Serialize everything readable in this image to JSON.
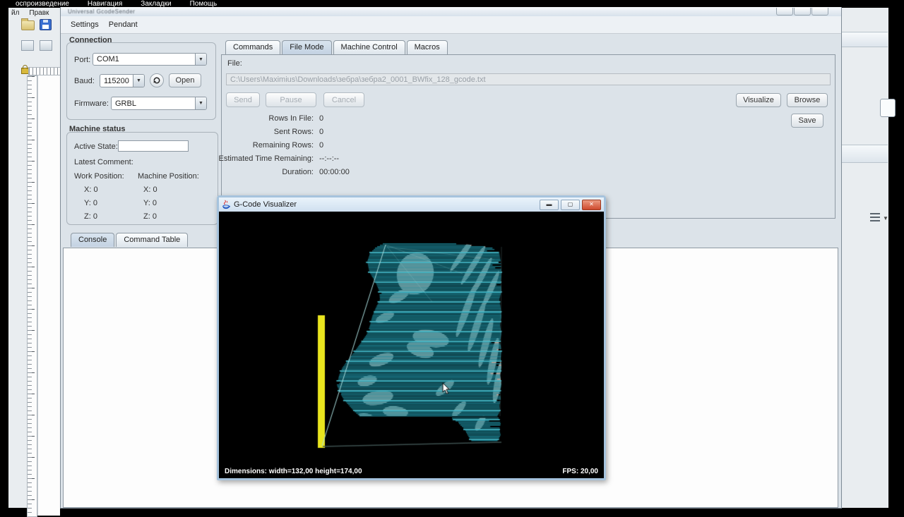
{
  "player_menu": {
    "items": [
      "оспроизведение",
      "Навигация",
      "Закладки",
      "Помощь"
    ]
  },
  "background_app": {
    "menu_items": [
      "йл",
      "Правк"
    ]
  },
  "main_window": {
    "title": "Universal GcodeSender",
    "menus": [
      "Settings",
      "Pendant"
    ],
    "connection": {
      "header": "Connection",
      "port_label": "Port:",
      "port_value": "COM1",
      "baud_label": "Baud:",
      "baud_value": "115200",
      "open_button": "Open",
      "firmware_label": "Firmware:",
      "firmware_value": "GRBL"
    },
    "machine_status": {
      "header": "Machine status",
      "active_state_label": "Active State:",
      "latest_comment_label": "Latest Comment:",
      "work_position_label": "Work Position:",
      "machine_position_label": "Machine Position:",
      "work_x": "X: 0",
      "work_y": "Y: 0",
      "work_z": "Z: 0",
      "machine_x": "X: 0",
      "machine_y": "Y: 0",
      "machine_z": "Z: 0"
    },
    "tabs": [
      "Commands",
      "File Mode",
      "Machine Control",
      "Macros"
    ],
    "active_tab": "File Mode",
    "file_mode": {
      "file_label": "File:",
      "file_path": "C:\\Users\\Maximius\\Downloads\\зебра\\зебра2_0001_BWfix_128_gcode.txt",
      "send_button": "Send",
      "pause_button": "Pause",
      "cancel_button": "Cancel",
      "stats": [
        {
          "label": "Rows In File:",
          "value": "0"
        },
        {
          "label": "Sent Rows:",
          "value": "0"
        },
        {
          "label": "Remaining Rows:",
          "value": "0"
        },
        {
          "label": "Estimated Time Remaining:",
          "value": "--:--:--"
        },
        {
          "label": "Duration:",
          "value": "00:00:00"
        }
      ],
      "visualize_button": "Visualize",
      "browse_button": "Browse",
      "save_button": "Save"
    },
    "console_tabs": [
      "Console",
      "Command Table"
    ],
    "active_console_tab": "Console"
  },
  "visualizer": {
    "title": "G-Code Visualizer",
    "dimensions_text": "Dimensions: width=132,00 height=174,00",
    "fps_text": "FPS: 20,00",
    "scene": {
      "bg": "#000000",
      "teal": "#1d8c9e",
      "teal_bright": "#45b7c6",
      "gray": "#a89f98",
      "yellow": "#e9e51e",
      "guide": "#a8dcdc",
      "floor": "#3c4f4e",
      "row_step": 2,
      "body": [
        [
          45,
          232,
          336
        ],
        [
          50,
          222,
          386
        ],
        [
          58,
          214,
          397
        ],
        [
          70,
          210,
          399
        ],
        [
          85,
          213,
          400
        ],
        [
          100,
          222,
          399
        ],
        [
          112,
          227,
          400
        ],
        [
          124,
          228,
          397
        ],
        [
          136,
          222,
          399
        ],
        [
          148,
          217,
          400
        ],
        [
          160,
          214,
          398
        ],
        [
          172,
          210,
          400
        ],
        [
          184,
          202,
          398
        ],
        [
          196,
          193,
          400
        ],
        [
          208,
          184,
          399
        ],
        [
          220,
          175,
          400
        ],
        [
          232,
          170,
          398
        ],
        [
          245,
          167,
          400
        ],
        [
          256,
          171,
          398
        ],
        [
          266,
          177,
          399
        ],
        [
          274,
          184,
          397
        ],
        [
          282,
          191,
          398
        ],
        [
          290,
          200,
          394
        ]
      ],
      "leg": [
        [
          292,
          330,
          396
        ],
        [
          300,
          340,
          399
        ],
        [
          308,
          348,
          397
        ],
        [
          316,
          352,
          399
        ],
        [
          325,
          358,
          394
        ]
      ],
      "yellow_bar": [
        140,
        147,
        10,
        188
      ],
      "diag": [
        236,
        47,
        146,
        332
      ],
      "floor_line": [
        147,
        333,
        400,
        327
      ],
      "patches": [
        [
          278,
          88,
          26,
          30,
          15
        ],
        [
          345,
          60,
          30,
          4,
          -55
        ],
        [
          360,
          76,
          32,
          4,
          -58
        ],
        [
          372,
          92,
          30,
          4,
          -62
        ],
        [
          385,
          110,
          28,
          4,
          -66
        ],
        [
          300,
          180,
          26,
          12,
          10
        ],
        [
          285,
          196,
          20,
          10,
          20
        ],
        [
          350,
          140,
          40,
          5,
          -70
        ],
        [
          365,
          162,
          38,
          5,
          -72
        ],
        [
          378,
          186,
          36,
          5,
          -75
        ],
        [
          388,
          212,
          34,
          5,
          -78
        ],
        [
          395,
          242,
          30,
          5,
          -80
        ],
        [
          225,
          264,
          22,
          10,
          -10
        ],
        [
          250,
          284,
          18,
          8,
          5
        ],
        [
          205,
          294,
          15,
          8,
          0
        ],
        [
          240,
          300,
          12,
          6,
          0
        ],
        [
          230,
          210,
          18,
          8,
          -20
        ],
        [
          210,
          240,
          14,
          7,
          -15
        ],
        [
          320,
          250,
          16,
          6,
          -40
        ],
        [
          340,
          280,
          14,
          5,
          -50
        ],
        [
          370,
          300,
          12,
          5,
          -60
        ],
        [
          255,
          120,
          16,
          7,
          -30
        ],
        [
          235,
          150,
          14,
          6,
          -25
        ]
      ],
      "streaks": [
        [
          236,
          47,
          345,
          88
        ],
        [
          236,
          47,
          302,
          128
        ],
        [
          238,
          50,
          390,
          68
        ],
        [
          400,
          50,
          398,
          290
        ]
      ],
      "cursor": [
        317,
        243
      ]
    }
  }
}
